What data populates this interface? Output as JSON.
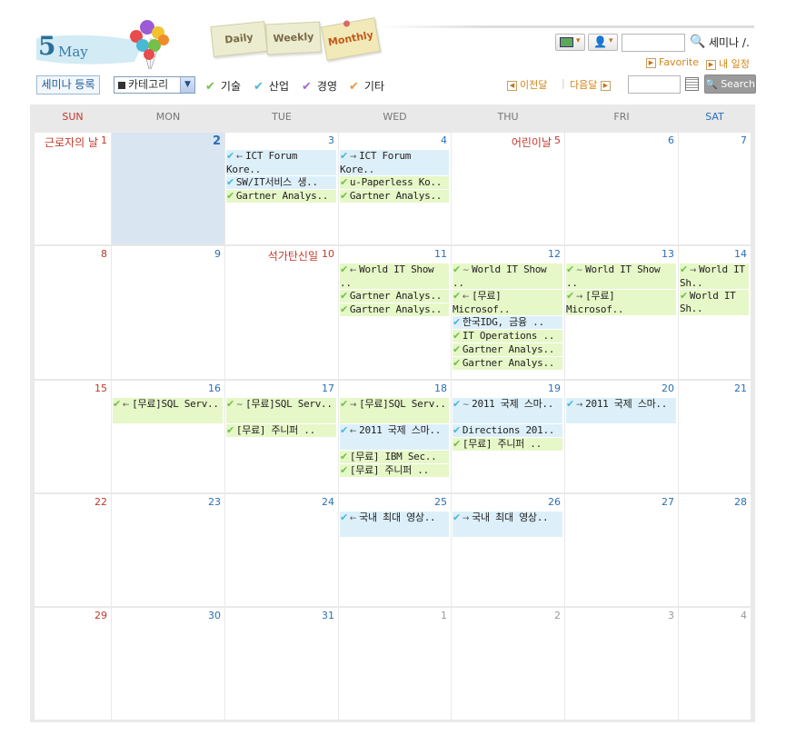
{
  "header": {
    "month_number": "5",
    "month_name": "May",
    "tabs": [
      "Daily",
      "Weekly",
      "Monthly"
    ],
    "active_tab": "Monthly",
    "search_label": "세미나 /.",
    "favorite_link": "Favorite",
    "my_schedule_link": "내 일정"
  },
  "toolbar": {
    "register_button": "세미나 등록",
    "category_select": "카테고리",
    "legend": [
      {
        "label": "기술",
        "color": "#73c04a"
      },
      {
        "label": "산업",
        "color": "#48b8d8"
      },
      {
        "label": "경영",
        "color": "#a36ad0"
      },
      {
        "label": "기타",
        "color": "#e59a3c"
      }
    ],
    "prev_label": "이전달",
    "next_label": "다음달",
    "search_button": "Search"
  },
  "weekdays": [
    "SUN",
    "MON",
    "TUE",
    "WED",
    "THU",
    "FRI",
    "SAT"
  ],
  "weeks": [
    [
      {
        "day": "1",
        "holiday": "근로자의 날",
        "events": []
      },
      {
        "day": "2",
        "today": true,
        "events": []
      },
      {
        "day": "3",
        "events": [
          {
            "text": "ICT Forum Kore..",
            "cat": "ind",
            "arrow": "←",
            "lines": 2
          },
          {
            "text": "SW/IT서비스 생..",
            "cat": "ind"
          },
          {
            "text": "Gartner Analys..",
            "cat": "tech"
          }
        ]
      },
      {
        "day": "4",
        "events": [
          {
            "text": "ICT Forum Kore..",
            "cat": "ind",
            "arrow": "→",
            "lines": 2
          },
          {
            "text": "u-Paperless Ko..",
            "cat": "tech"
          },
          {
            "text": "Gartner Analys..",
            "cat": "tech"
          }
        ]
      },
      {
        "day": "5",
        "holiday": "어린이날",
        "events": []
      },
      {
        "day": "6",
        "events": []
      },
      {
        "day": "7",
        "events": []
      }
    ],
    [
      {
        "day": "8",
        "events": []
      },
      {
        "day": "9",
        "events": []
      },
      {
        "day": "10",
        "holiday": "석가탄신일",
        "events": []
      },
      {
        "day": "11",
        "events": [
          {
            "text": "World IT Show ..",
            "cat": "tech",
            "arrow": "←",
            "lines": 2
          },
          {
            "text": "Gartner Analys..",
            "cat": "tech"
          },
          {
            "text": "Gartner Analys..",
            "cat": "tech"
          }
        ]
      },
      {
        "day": "12",
        "events": [
          {
            "text": "World IT Show ..",
            "cat": "tech",
            "arrow": "~",
            "lines": 2
          },
          {
            "text": "[무료] Microsof..",
            "cat": "tech",
            "arrow": "←",
            "lines": 2
          },
          {
            "text": "한국IDG, 금융 ..",
            "cat": "ind"
          },
          {
            "text": "IT Operations ..",
            "cat": "tech"
          },
          {
            "text": "Gartner Analys..",
            "cat": "tech"
          },
          {
            "text": "Gartner Analys..",
            "cat": "tech"
          }
        ]
      },
      {
        "day": "13",
        "events": [
          {
            "text": "World IT Show ..",
            "cat": "tech",
            "arrow": "~",
            "lines": 2
          },
          {
            "text": "[무료] Microsof..",
            "cat": "tech",
            "arrow": "→",
            "lines": 2
          }
        ]
      },
      {
        "day": "14",
        "events": [
          {
            "text": "World IT Sh..",
            "cat": "tech",
            "arrow": "→",
            "lines": 2
          },
          {
            "text": "World IT Sh..",
            "cat": "tech",
            "lines": 2
          }
        ]
      }
    ],
    [
      {
        "day": "15",
        "events": []
      },
      {
        "day": "16",
        "events": [
          {
            "text": "[무료]SQL Serv..",
            "cat": "tech",
            "arrow": "←",
            "lines": 2
          }
        ]
      },
      {
        "day": "17",
        "events": [
          {
            "text": "[무료]SQL Serv..",
            "cat": "tech",
            "arrow": "~",
            "lines": 2
          },
          {
            "text": "[무료] 주니퍼 ..",
            "cat": "tech"
          }
        ]
      },
      {
        "day": "18",
        "events": [
          {
            "text": "[무료]SQL Serv..",
            "cat": "tech",
            "arrow": "→",
            "lines": 2
          },
          {
            "text": "2011 국제 스마..",
            "cat": "ind",
            "arrow": "←",
            "lines": 2
          },
          {
            "text": "[무료] IBM Sec..",
            "cat": "tech"
          },
          {
            "text": "[무료] 주니퍼 ..",
            "cat": "tech"
          }
        ]
      },
      {
        "day": "19",
        "events": [
          {
            "text": "2011 국제 스마..",
            "cat": "ind",
            "arrow": "~",
            "lines": 2
          },
          {
            "text": "Directions 201..",
            "cat": "ind"
          },
          {
            "text": "[무료] 주니퍼 ..",
            "cat": "tech"
          }
        ]
      },
      {
        "day": "20",
        "events": [
          {
            "text": "2011 국제 스마..",
            "cat": "ind",
            "arrow": "→",
            "lines": 2
          }
        ]
      },
      {
        "day": "21",
        "events": []
      }
    ],
    [
      {
        "day": "22",
        "events": []
      },
      {
        "day": "23",
        "events": []
      },
      {
        "day": "24",
        "events": []
      },
      {
        "day": "25",
        "events": [
          {
            "text": "국내 최대 영상..",
            "cat": "ind",
            "arrow": "←",
            "lines": 2
          }
        ]
      },
      {
        "day": "26",
        "events": [
          {
            "text": "국내 최대 영상..",
            "cat": "ind",
            "arrow": "→",
            "lines": 2
          }
        ]
      },
      {
        "day": "27",
        "events": []
      },
      {
        "day": "28",
        "events": []
      }
    ],
    [
      {
        "day": "29",
        "events": []
      },
      {
        "day": "30",
        "events": []
      },
      {
        "day": "31",
        "events": []
      },
      {
        "day": "1",
        "other": true,
        "events": []
      },
      {
        "day": "2",
        "other": true,
        "events": []
      },
      {
        "day": "3",
        "other": true,
        "events": []
      },
      {
        "day": "4",
        "other": true,
        "events": []
      }
    ]
  ]
}
